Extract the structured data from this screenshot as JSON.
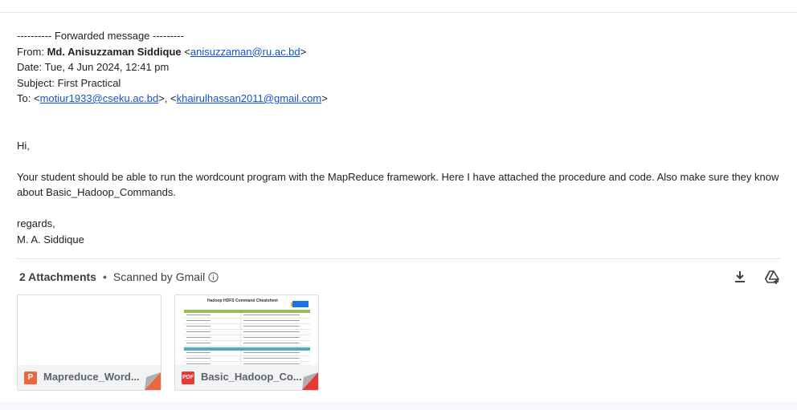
{
  "email": {
    "forwarded_line": "---------- Forwarded message ---------",
    "from_label": "From: ",
    "from_name": "Md. Anisuzzaman Siddique",
    "from_email": "anisuzzaman@ru.ac.bd",
    "date_line": "Date: Tue, 4 Jun 2024, 12:41 pm",
    "subject_line": "Subject: First Practical",
    "to_label": "To: ",
    "to_email_1": "motiur1933@cseku.ac.bd",
    "to_email_2": "khairulhassan2011@gmail.com",
    "greeting": "Hi,",
    "body_line_1": "Your student should be able to run the wordcount program with the MapReduce framework. Here I have attached the procedure and code. Also make sure they know",
    "body_line_2": "about Basic_Hadoop_Commands.",
    "closing": "regards,",
    "signature": "M. A. Siddique"
  },
  "attachments": {
    "count_label": "2 Attachments",
    "scanned_label": "Scanned by Gmail",
    "items": [
      {
        "name": "Mapreduce_Word...",
        "type_glyph": "P",
        "icon_color": "#e8693f",
        "corner_color": "#e8693f"
      },
      {
        "name": "Basic_Hadoop_Co...",
        "type_glyph": "PDF",
        "icon_color": "#e53935",
        "corner_color": "#e53935",
        "thumb_title": "Hadoop HDFS Command Cheatsheet"
      }
    ]
  },
  "icons": {
    "info": "info-icon",
    "download_all": "download-icon",
    "add_to_drive": "add-to-drive-icon"
  },
  "colors": {
    "link": "#1155cc",
    "pdf_table_header_green": "#9bbb59",
    "pdf_table_header_blue": "#4bacc6"
  }
}
